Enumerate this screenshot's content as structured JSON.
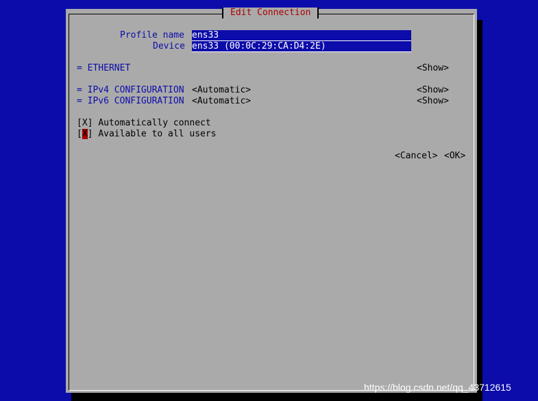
{
  "dialog": {
    "title": "Edit Connection",
    "profile_name_label": "Profile name",
    "profile_name_value": "ens33",
    "device_label": "Device",
    "device_value": "ens33 (00:0C:29:CA:D4:2E)",
    "ethernet_label": "= ETHERNET",
    "ethernet_show": "<Show>",
    "ipv4_label": "= IPv4 CONFIGURATION",
    "ipv4_mode": "<Automatic>",
    "ipv4_show": "<Show>",
    "ipv6_label": "= IPv6 CONFIGURATION",
    "ipv6_mode": "<Automatic>",
    "ipv6_show": "<Show>",
    "auto_connect": {
      "bracket_open": "[",
      "mark": "X",
      "bracket_close": "]",
      "label": "Automatically connect"
    },
    "all_users": {
      "bracket_open": "[",
      "mark": "X",
      "bracket_close": "]",
      "label": "Available to all users"
    },
    "cancel_label": "<Cancel>",
    "ok_label": "<OK>"
  },
  "watermark": "https://blog.csdn.net/qq_43712615",
  "colors": {
    "background_blue": "#0c0caa",
    "dialog_gray": "#aaaaaa",
    "title_red": "#aa0000"
  }
}
